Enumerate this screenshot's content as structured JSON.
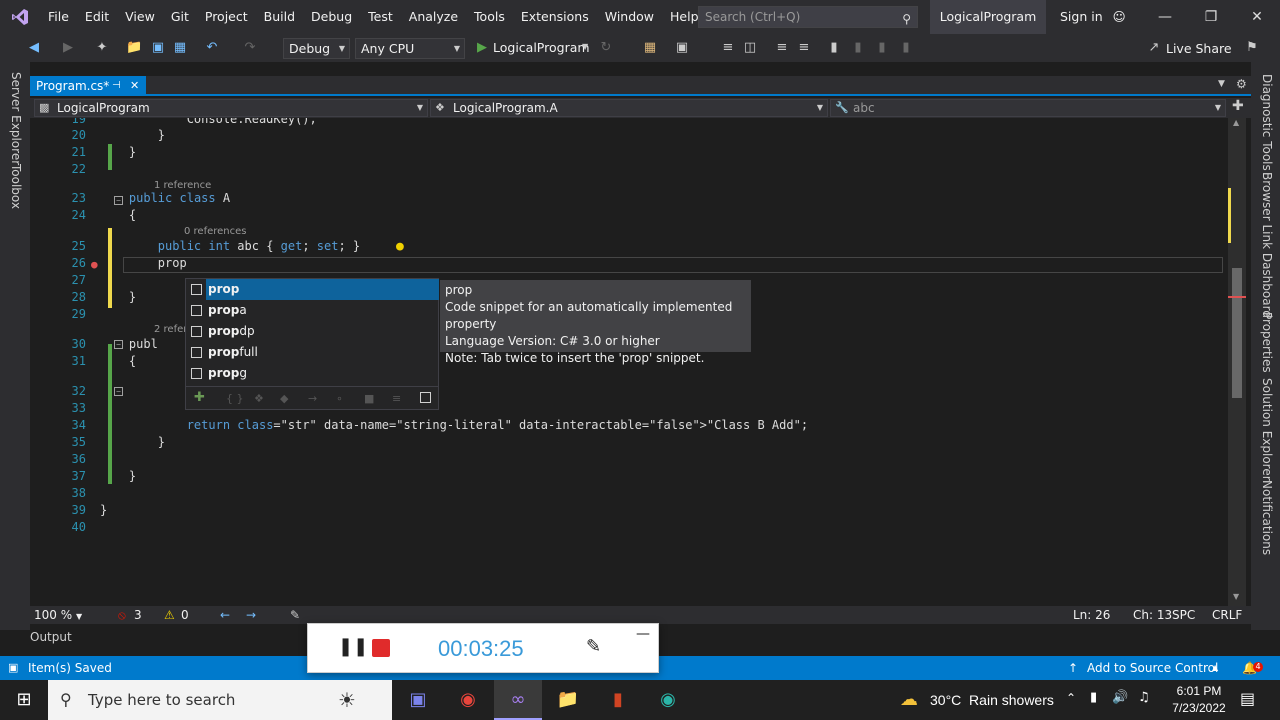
{
  "menubar": {
    "items": [
      "File",
      "Edit",
      "View",
      "Git",
      "Project",
      "Build",
      "Debug",
      "Test",
      "Analyze",
      "Tools",
      "Extensions",
      "Window",
      "Help"
    ],
    "search_placeholder": "Search (Ctrl+Q)",
    "solution_name": "LogicalProgram",
    "sign_in": "Sign in"
  },
  "toolbar": {
    "config": "Debug",
    "platform": "Any CPU",
    "start_target": "LogicalProgram",
    "live_share": "Live Share"
  },
  "left_rail": {
    "tabs": [
      "Server Explorer",
      "Toolbox"
    ]
  },
  "right_rail": {
    "tabs": [
      "Diagnostic Tools",
      "Browser Link Dashboard",
      "Properties",
      "Solution Explorer",
      "Notifications"
    ]
  },
  "document_tab": {
    "label": "Program.cs*",
    "pin": "⊣",
    "close": "✕"
  },
  "navbar": {
    "project": "LogicalProgram",
    "type": "LogicalProgram.A",
    "member": "abc"
  },
  "editor": {
    "lines": [
      {
        "n": "19",
        "text": "            Console.ReadKey();"
      },
      {
        "n": "20",
        "text": "        }"
      },
      {
        "n": "21",
        "text": "    }"
      },
      {
        "n": "22",
        "text": ""
      },
      {
        "n": "23",
        "text": "    public class A"
      },
      {
        "n": "24",
        "text": "    {"
      },
      {
        "n": "25",
        "text": "        public int abc { get; set; }"
      },
      {
        "n": "26",
        "text": "        prop"
      },
      {
        "n": "27",
        "text": ""
      },
      {
        "n": "28",
        "text": "    }"
      },
      {
        "n": "29",
        "text": ""
      },
      {
        "n": "30",
        "text": "    publ"
      },
      {
        "n": "31",
        "text": "    {"
      },
      {
        "n": "32",
        "text": ""
      },
      {
        "n": "33",
        "text": ""
      },
      {
        "n": "34",
        "text": "            return \"Class B Add\";"
      },
      {
        "n": "35",
        "text": "        }"
      },
      {
        "n": "36",
        "text": ""
      },
      {
        "n": "37",
        "text": "    }"
      },
      {
        "n": "38",
        "text": ""
      },
      {
        "n": "39",
        "text": "}"
      },
      {
        "n": "40",
        "text": ""
      }
    ],
    "lens_1": "1 reference",
    "lens_2": "0 references",
    "lens_3": "2 refer"
  },
  "completion": {
    "items": [
      {
        "bold": "prop",
        "rest": ""
      },
      {
        "bold": "prop",
        "rest": "a"
      },
      {
        "bold": "prop",
        "rest": "dp"
      },
      {
        "bold": "prop",
        "rest": "full"
      },
      {
        "bold": "prop",
        "rest": "g"
      }
    ]
  },
  "tooltip": {
    "title": "prop",
    "line1": "Code snippet for an automatically implemented property",
    "line2": "Language Version: C# 3.0 or higher",
    "line3": "Note: Tab twice to insert the 'prop' snippet."
  },
  "editor_status": {
    "zoom": "100 %",
    "errors": "3",
    "warnings": "0",
    "line": "Ln: 26",
    "col": "Ch: 13",
    "spc": "SPC",
    "eol": "CRLF"
  },
  "output_tab": "Output",
  "recorder": {
    "time": "00:03:25"
  },
  "statusbar": {
    "message": "Item(s) Saved",
    "source_control": "Add to Source Control",
    "notifications": "4"
  },
  "taskbar": {
    "search_placeholder": "Type here to search",
    "weather": "30°C  Rain showers",
    "time": "6:01 PM",
    "date": "7/23/2022"
  },
  "colors": {
    "accent": "#007acc",
    "keyword": "#569cd6",
    "string": "#d69d85",
    "linenum": "#2b91af"
  }
}
